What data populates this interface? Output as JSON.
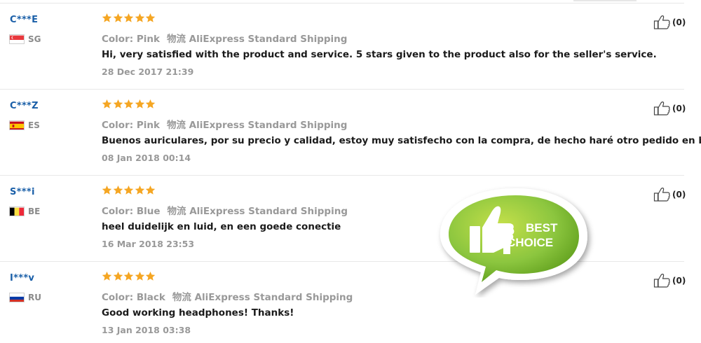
{
  "reviews": [
    {
      "user": "C***E",
      "country_code": "SG",
      "flag": "sg",
      "rating": 5,
      "color_label": "Color:",
      "color_value": "Pink",
      "shipping_label": "物流",
      "shipping_value": "AliExpress Standard Shipping",
      "feedback": "Hi, very satisfied with the product and service. 5 stars given to the product also for the seller's service.",
      "date": "28 Dec 2017 21:39",
      "helpful_count": "(0)"
    },
    {
      "user": "C***Z",
      "country_code": "ES",
      "flag": "es",
      "rating": 5,
      "color_label": "Color:",
      "color_value": "Pink",
      "shipping_label": "物流",
      "shipping_value": "AliExpress Standard Shipping",
      "feedback": "Buenos auriculares, por su precio y calidad, estoy muy satisfecho con la compra, de hecho haré otro pedido en breve.",
      "date": "08 Jan 2018 00:14",
      "helpful_count": "(0)"
    },
    {
      "user": "S***i",
      "country_code": "BE",
      "flag": "be",
      "rating": 5,
      "color_label": "Color:",
      "color_value": "Blue",
      "shipping_label": "物流",
      "shipping_value": "AliExpress Standard Shipping",
      "feedback": "heel duidelijk en luid, en een goede conectie",
      "date": "16 Mar 2018 23:53",
      "helpful_count": "(0)"
    },
    {
      "user": "I***v",
      "country_code": "RU",
      "flag": "ru",
      "rating": 5,
      "color_label": "Color:",
      "color_value": "Black",
      "shipping_label": "物流",
      "shipping_value": "AliExpress Standard Shipping",
      "feedback": "Good working headphones! Thanks!",
      "date": "13 Jan 2018 03:38",
      "helpful_count": "(0)"
    }
  ],
  "badge": {
    "line1": "BEST",
    "line2": "CHOICE"
  },
  "colors": {
    "username": "#1a5fa8",
    "star": "#f5a623",
    "muted": "#999999",
    "badge_green": "#8cc63f"
  },
  "icons": {
    "rating": "star-icon",
    "helpful": "thumbs-up-icon"
  }
}
